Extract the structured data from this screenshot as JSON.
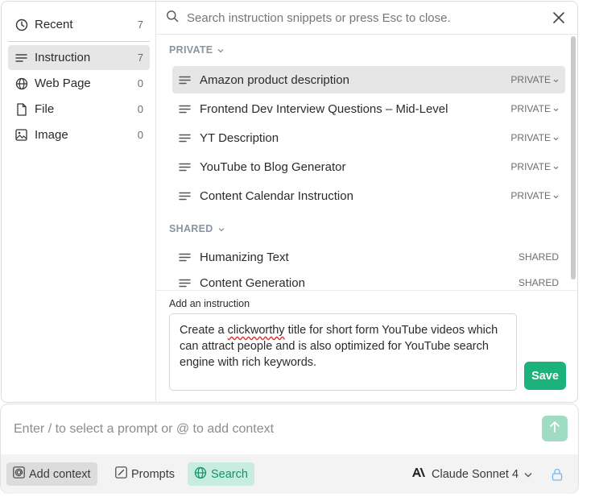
{
  "sidebar": {
    "items": [
      {
        "label": "Recent",
        "count": "7",
        "icon": "clock-icon"
      },
      {
        "label": "Instruction",
        "count": "7",
        "icon": "lines-icon"
      },
      {
        "label": "Web Page",
        "count": "0",
        "icon": "globe-icon"
      },
      {
        "label": "File",
        "count": "0",
        "icon": "file-icon"
      },
      {
        "label": "Image",
        "count": "0",
        "icon": "image-icon"
      }
    ]
  },
  "search": {
    "placeholder": "Search instruction snippets or press Esc to close."
  },
  "sections": {
    "private": {
      "title": "PRIVATE",
      "items": [
        {
          "title": "Amazon product description",
          "tag": "PRIVATE"
        },
        {
          "title": "Frontend Dev Interview Questions – Mid-Level",
          "tag": "PRIVATE"
        },
        {
          "title": "YT Description",
          "tag": "PRIVATE"
        },
        {
          "title": "YouTube to Blog Generator",
          "tag": "PRIVATE"
        },
        {
          "title": "Content Calendar Instruction",
          "tag": "PRIVATE"
        }
      ]
    },
    "shared": {
      "title": "SHARED",
      "items": [
        {
          "title": "Humanizing Text",
          "tag": "SHARED"
        },
        {
          "title": "Content Generation",
          "tag": "SHARED"
        }
      ]
    }
  },
  "add_instruction": {
    "label": "Add an instruction",
    "text_before": "Create a ",
    "misspelled": "clickworthy",
    "text_after": " title for short form YouTube videos which can attract people and is also optimized for YouTube search engine with rich keywords.",
    "save_label": "Save"
  },
  "composer": {
    "placeholder": "Enter / to select a prompt or @ to add context",
    "add_context_label": "Add context",
    "prompts_label": "Prompts",
    "search_label": "Search",
    "model_label": "Claude Sonnet 4"
  },
  "colors": {
    "accent": "#1bb27b",
    "search_bg": "#c6ede0",
    "hover_bg": "#e6e6e6"
  }
}
